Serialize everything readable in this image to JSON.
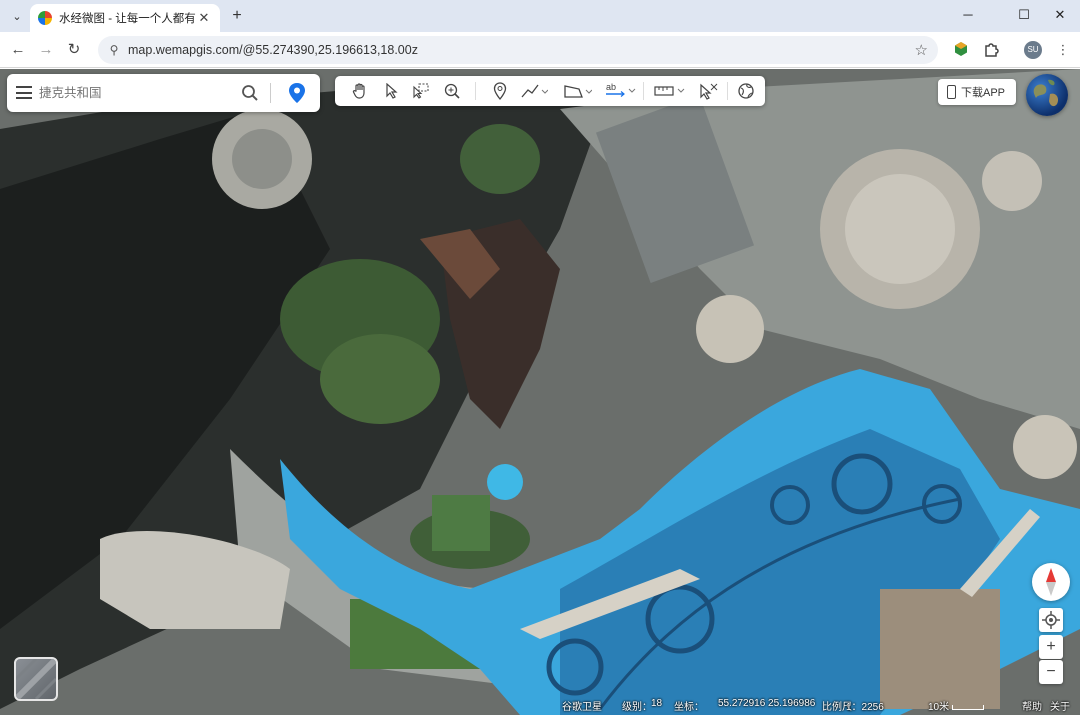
{
  "browser": {
    "tab_title": "水经微图 - 让每一个人都有自己",
    "url": "map.wemapgis.com/@55.274390,25.196613,18.00z",
    "profile_initials": "SU"
  },
  "map": {
    "search_placeholder": "捷克共和国",
    "download_label": "下载APP",
    "status": {
      "source": "谷歌卫星",
      "level_label": "级别：",
      "level_value": "18",
      "coord_label": "坐标：",
      "coord_value": "55.272916 25.196986",
      "scale_label": "比例尺",
      "scale_value": "1：2256",
      "scale_bar_label": "10米",
      "help_label": "帮助",
      "about_label": "关于"
    },
    "accent_color": "#1a73e8"
  }
}
